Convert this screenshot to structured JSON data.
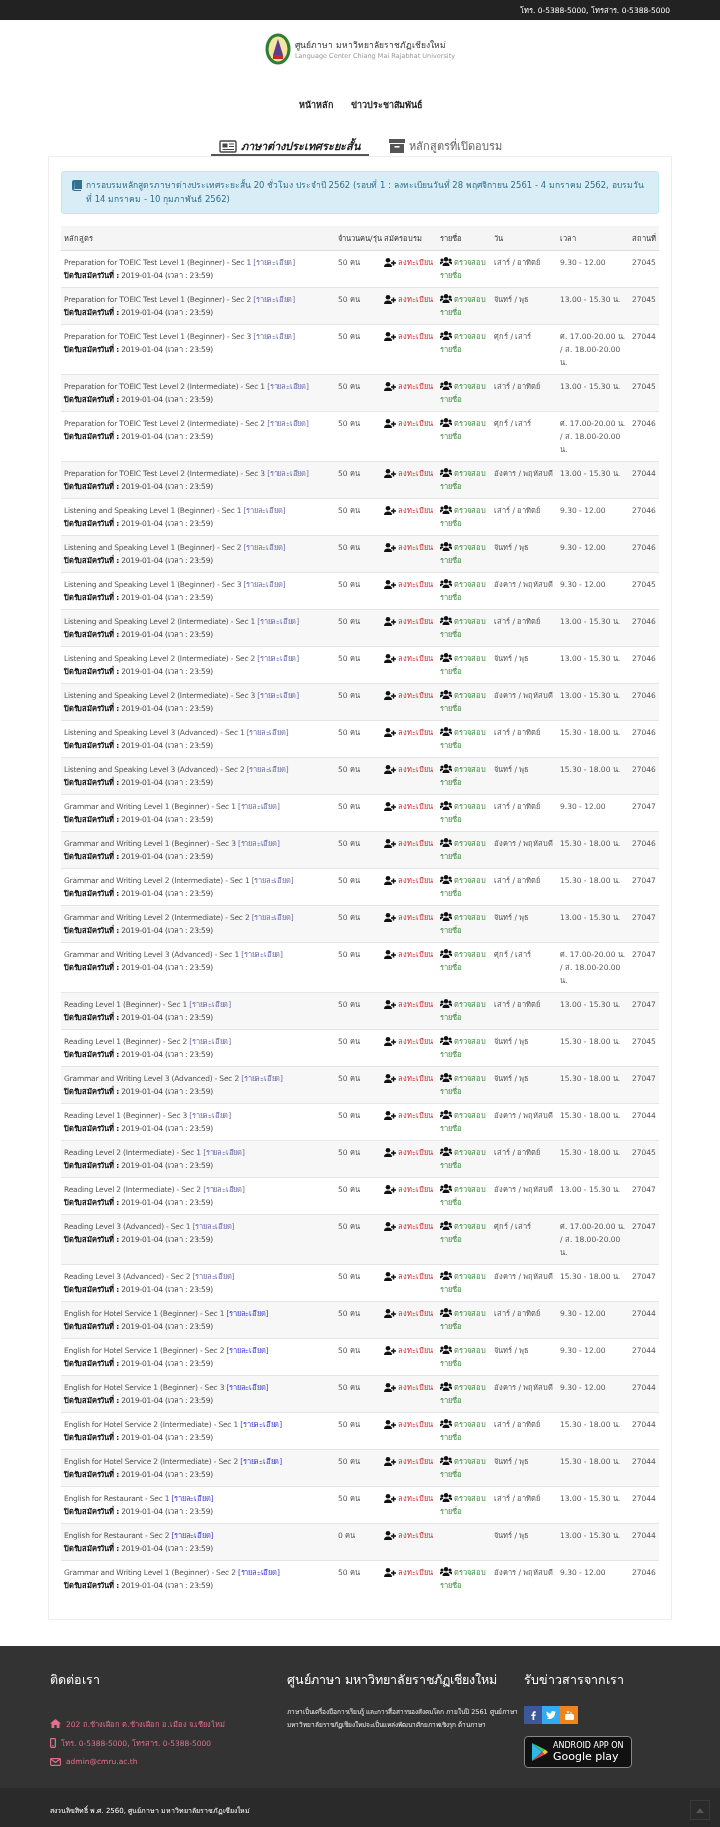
{
  "top_bar": {
    "contact": "โทร. 0-5388-5000, โทรสาร. 0-5388-5000"
  },
  "logo": {
    "title": "ศูนย์ภาษา มหาวิทยาลัยราชภัฏเชียงใหม่",
    "subtitle": "Language Center Chiang Mai Rajabhat University"
  },
  "nav": [
    "หน้าหลัก",
    "ข่าวประชาสัมพันธ์"
  ],
  "tabs": [
    {
      "label": "ภาษาต่างประเทศระยะสั้น",
      "selected": true
    },
    {
      "label": "หลักสูตรที่เปิดอบรม",
      "selected": false
    }
  ],
  "alert": "การอบรมหลักสูตรภาษาต่างประเทศระยะสั้น 20 ชั่วโมง ประจำปี 2562 (รอบที่ 1 : ลงทะเบียนวันที่ 28 พฤศจิกายน 2561 - 4 มกราคม 2562, อบรมวันที่ 14 มกราคม - 10 กุมภาพันธ์ 2562)",
  "table": {
    "columns": [
      "หลักสูตร",
      "จำนวนคน/รุ่น",
      "สมัครอบรม",
      "รายชื่อ",
      "วัน",
      "เวลา",
      "สถานที่"
    ],
    "rows": [
      {
        "course": "Preparation for TOEIC Test Level 1 (Beginner) - Sec 1",
        "detail": "[รายละเอียด]",
        "visited": true,
        "closing": "**ปิดรับสมัครวันที่ :** 2019-01-04 (เวลา : 23:59)",
        "count": "50 คน",
        "register": "ลงทะเบียน",
        "list": "ตรวจสอบรายชื่อ",
        "day": "เสาร์ / อาทิตย์",
        "time": "9.30 - 12.00",
        "place": "27045"
      },
      {
        "course": "Preparation for TOEIC Test Level 1 (Beginner) - Sec 2",
        "detail": "[รายละเอียด]",
        "visited": true,
        "closing": "**ปิดรับสมัครวันที่ :** 2019-01-04 (เวลา : 23:59)",
        "count": "50 คน",
        "register": "ลงทะเบียน",
        "list": "ตรวจสอบรายชื่อ",
        "day": "จันทร์ / พุธ",
        "time": "13.00 - 15.30 น.",
        "place": "27045"
      },
      {
        "course": "Preparation for TOEIC Test Level 1 (Beginner) - Sec 3",
        "detail": "[รายละเอียด]",
        "visited": true,
        "closing": "**ปิดรับสมัครวันที่ :** 2019-01-04 (เวลา : 23:59)",
        "count": "50 คน",
        "register": "ลงทะเบียน",
        "list": "ตรวจสอบรายชื่อ",
        "day": "ศุกร์ / เสาร์",
        "time": "ศ. 17.00-20.00 น. / ส. 18.00-20.00 น.",
        "place": "27044"
      },
      {
        "course": "Preparation for TOEIC Test Level 2 (Intermediate) - Sec 1",
        "detail": "[รายละเอียด]",
        "visited": true,
        "closing": "**ปิดรับสมัครวันที่ :** 2019-01-04 (เวลา : 23:59)",
        "count": "50 คน",
        "register": "ลงทะเบียน",
        "list": "ตรวจสอบรายชื่อ",
        "day": "เสาร์ / อาทิตย์",
        "time": "13.00 - 15.30 น.",
        "place": "27045"
      },
      {
        "course": "Preparation for TOEIC Test Level 2 (Intermediate) - Sec 2",
        "detail": "[รายละเอียด]",
        "visited": true,
        "closing": "**ปิดรับสมัครวันที่ :** 2019-01-04 (เวลา : 23:59)",
        "count": "50 คน",
        "register": "ลงทะเบียน",
        "list": "ตรวจสอบรายชื่อ",
        "day": "ศุกร์ / เสาร์",
        "time": "ศ. 17.00-20.00 น. / ส. 18.00-20.00 น.",
        "place": "27046"
      },
      {
        "course": "Preparation for TOEIC Test Level 2 (Intermediate) - Sec 3",
        "detail": "[รายละเอียด]",
        "visited": true,
        "closing": "**ปิดรับสมัครวันที่ :** 2019-01-04 (เวลา : 23:59)",
        "count": "50 คน",
        "register": "ลงทะเบียน",
        "list": "ตรวจสอบรายชื่อ",
        "day": "อังคาร / พฤหัสบดี",
        "time": "13.00 - 15.30 น.",
        "place": "27044"
      },
      {
        "course": "Listening and Speaking Level 1 (Beginner) - Sec 1",
        "detail": "[รายละเอียด]",
        "visited": true,
        "closing": "**ปิดรับสมัครวันที่ :** 2019-01-04 (เวลา : 23:59)",
        "count": "50 คน",
        "register": "ลงทะเบียน",
        "list": "ตรวจสอบรายชื่อ",
        "day": "เสาร์ / อาทิตย์",
        "time": "9.30 - 12.00",
        "place": "27046"
      },
      {
        "course": "Listening and Speaking Level 1 (Beginner) - Sec 2",
        "detail": "[รายละเอียด]",
        "visited": true,
        "closing": "**ปิดรับสมัครวันที่ :** 2019-01-04 (เวลา : 23:59)",
        "count": "50 คน",
        "register": "ลงทะเบียน",
        "list": "ตรวจสอบรายชื่อ",
        "day": "จันทร์ / พุธ",
        "time": "9.30 - 12.00",
        "place": "27046"
      },
      {
        "course": "Listening and Speaking Level 1 (Beginner) - Sec 3",
        "detail": "[รายละเอียด]",
        "visited": true,
        "closing": "**ปิดรับสมัครวันที่ :** 2019-01-04 (เวลา : 23:59)",
        "count": "50 คน",
        "register": "ลงทะเบียน",
        "list": "ตรวจสอบรายชื่อ",
        "day": "อังคาร / พฤหัสบดี",
        "time": "9.30 - 12.00",
        "place": "27045"
      },
      {
        "course": "Listening and Speaking Level 2 (Intermediate) - Sec 1",
        "detail": "[รายละเอียด]",
        "visited": true,
        "closing": "**ปิดรับสมัครวันที่ :** 2019-01-04 (เวลา : 23:59)",
        "count": "50 คน",
        "register": "ลงทะเบียน",
        "list": "ตรวจสอบรายชื่อ",
        "day": "เสาร์ / อาทิตย์",
        "time": "13.00 - 15.30 น.",
        "place": "27046"
      },
      {
        "course": "Listening and Speaking Level 2 (Intermediate) - Sec 2",
        "detail": "[รายละเอียด]",
        "visited": true,
        "closing": "**ปิดรับสมัครวันที่ :** 2019-01-04 (เวลา : 23:59)",
        "count": "50 คน",
        "register": "ลงทะเบียน",
        "list": "ตรวจสอบรายชื่อ",
        "day": "จันทร์ / พุธ",
        "time": "13.00 - 15.30 น.",
        "place": "27046"
      },
      {
        "course": "Listening and Speaking Level 2 (Intermediate) - Sec 3",
        "detail": "[รายละเอียด]",
        "visited": true,
        "closing": "**ปิดรับสมัครวันที่ :** 2019-01-04 (เวลา : 23:59)",
        "count": "50 คน",
        "register": "ลงทะเบียน",
        "list": "ตรวจสอบรายชื่อ",
        "day": "อังคาร / พฤหัสบดี",
        "time": "13.00 - 15.30 น.",
        "place": "27046"
      },
      {
        "course": "Listening and Speaking Level 3 (Advanced) - Sec 1",
        "detail": "[รายละเอียด]",
        "visited": true,
        "closing": "**ปิดรับสมัครวันที่ :** 2019-01-04 (เวลา : 23:59)",
        "count": "50 คน",
        "register": "ลงทะเบียน",
        "list": "ตรวจสอบรายชื่อ",
        "day": "เสาร์ / อาทิตย์",
        "time": "15.30 - 18.00 น.",
        "place": "27046"
      },
      {
        "course": "Listening and Speaking Level 3 (Advanced) - Sec 2",
        "detail": "[รายละเอียด]",
        "visited": true,
        "closing": "**ปิดรับสมัครวันที่ :** 2019-01-04 (เวลา : 23:59)",
        "count": "50 คน",
        "register": "ลงทะเบียน",
        "list": "ตรวจสอบรายชื่อ",
        "day": "จันทร์ / พุธ",
        "time": "15.30 - 18.00 น.",
        "place": "27046"
      },
      {
        "course": "Grammar and Writing Level 1 (Beginner) - Sec 1",
        "detail": "[รายละเอียด]",
        "visited": true,
        "closing": "**ปิดรับสมัครวันที่ :** 2019-01-04 (เวลา : 23:59)",
        "count": "50 คน",
        "register": "ลงทะเบียน",
        "list": "ตรวจสอบรายชื่อ",
        "day": "เสาร์ / อาทิตย์",
        "time": "9.30 - 12.00",
        "place": "27047"
      },
      {
        "course": "Grammar and Writing Level 1 (Beginner) - Sec 3",
        "detail": "[รายละเอียด]",
        "visited": true,
        "closing": "**ปิดรับสมัครวันที่ :** 2019-01-04 (เวลา : 23:59)",
        "count": "50 คน",
        "register": "ลงทะเบียน",
        "list": "ตรวจสอบรายชื่อ",
        "day": "อังคาร / พฤหัสบดี",
        "time": "15.30 - 18.00 น.",
        "place": "27046"
      },
      {
        "course": "Grammar and Writing Level 2 (Intermediate) - Sec 1",
        "detail": "[รายละเอียด]",
        "visited": true,
        "closing": "**ปิดรับสมัครวันที่ :** 2019-01-04 (เวลา : 23:59)",
        "count": "50 คน",
        "register": "ลงทะเบียน",
        "list": "ตรวจสอบรายชื่อ",
        "day": "เสาร์ / อาทิตย์",
        "time": "15.30 - 18.00 น.",
        "place": "27047"
      },
      {
        "course": "Grammar and Writing Level 2 (Intermediate) - Sec 2",
        "detail": "[รายละเอียด]",
        "visited": true,
        "closing": "**ปิดรับสมัครวันที่ :** 2019-01-04 (เวลา : 23:59)",
        "count": "50 คน",
        "register": "ลงทะเบียน",
        "list": "ตรวจสอบรายชื่อ",
        "day": "จันทร์ / พุธ",
        "time": "13.00 - 15.30 น.",
        "place": "27047"
      },
      {
        "course": "Grammar and Writing Level 3 (Advanced) - Sec 1",
        "detail": "[รายละเอียด]",
        "visited": true,
        "closing": "**ปิดรับสมัครวันที่ :** 2019-01-04 (เวลา : 23:59)",
        "count": "50 คน",
        "register": "ลงทะเบียน",
        "list": "ตรวจสอบรายชื่อ",
        "day": "ศุกร์ / เสาร์",
        "time": "ศ. 17.00-20.00 น. / ส. 18.00-20.00 น.",
        "place": "27047"
      },
      {
        "course": "Reading Level 1 (Beginner) - Sec 1",
        "detail": "[รายละเอียด]",
        "visited": true,
        "closing": "**ปิดรับสมัครวันที่ :** 2019-01-04 (เวลา : 23:59)",
        "count": "50 คน",
        "register": "ลงทะเบียน",
        "list": "ตรวจสอบรายชื่อ",
        "day": "เสาร์ / อาทิตย์",
        "time": "13.00 - 15.30 น.",
        "place": "27047"
      },
      {
        "course": "Reading Level 1 (Beginner) - Sec 2",
        "detail": "[รายละเอียด]",
        "visited": true,
        "closing": "**ปิดรับสมัครวันที่ :** 2019-01-04 (เวลา : 23:59)",
        "count": "50 คน",
        "register": "ลงทะเบียน",
        "list": "ตรวจสอบรายชื่อ",
        "day": "จันทร์ / พุธ",
        "time": "15.30 - 18.00 น.",
        "place": "27045"
      },
      {
        "course": "Grammar and Writing Level 3 (Advanced) - Sec 2",
        "detail": "[รายละเอียด]",
        "visited": true,
        "closing": "**ปิดรับสมัครวันที่ :** 2019-01-04 (เวลา : 23:59)",
        "count": "50 คน",
        "register": "ลงทะเบียน",
        "list": "ตรวจสอบรายชื่อ",
        "day": "จันทร์ / พุธ",
        "time": "15.30 - 18.00 น.",
        "place": "27047"
      },
      {
        "course": "Reading Level 1 (Beginner) - Sec 3",
        "detail": "[รายละเอียด]",
        "visited": true,
        "closing": "**ปิดรับสมัครวันที่ :** 2019-01-04 (เวลา : 23:59)",
        "count": "50 คน",
        "register": "ลงทะเบียน",
        "list": "ตรวจสอบรายชื่อ",
        "day": "อังคาร / พฤหัสบดี",
        "time": "15.30 - 18.00 น.",
        "place": "27044"
      },
      {
        "course": "Reading Level 2 (Intermediate) - Sec 1",
        "detail": "[รายละเอียด]",
        "visited": true,
        "closing": "**ปิดรับสมัครวันที่ :** 2019-01-04 (เวลา : 23:59)",
        "count": "50 คน",
        "register": "ลงทะเบียน",
        "list": "ตรวจสอบรายชื่อ",
        "day": "เสาร์ / อาทิตย์",
        "time": "15.30 - 18.00 น.",
        "place": "27045"
      },
      {
        "course": "Reading Level 2 (Intermediate) - Sec 2",
        "detail": "[รายละเอียด]",
        "visited": true,
        "closing": "**ปิดรับสมัครวันที่ :** 2019-01-04 (เวลา : 23:59)",
        "count": "50 คน",
        "register": "ลงทะเบียน",
        "list": "ตรวจสอบรายชื่อ",
        "day": "อังคาร / พฤหัสบดี",
        "time": "13.00 - 15.30 น.",
        "place": "27047"
      },
      {
        "course": "Reading Level 3 (Advanced) - Sec 1",
        "detail": "[รายละเอียด]",
        "visited": true,
        "closing": "**ปิดรับสมัครวันที่ :** 2019-01-04 (เวลา : 23:59)",
        "count": "50 คน",
        "register": "ลงทะเบียน",
        "list": "ตรวจสอบรายชื่อ",
        "day": "ศุกร์ / เสาร์",
        "time": "ศ. 17.00-20.00 น. / ส. 18.00-20.00 น.",
        "place": "27047"
      },
      {
        "course": "Reading Level 3 (Advanced) - Sec 2",
        "detail": "[รายละเอียด]",
        "visited": true,
        "closing": "**ปิดรับสมัครวันที่ :** 2019-01-04 (เวลา : 23:59)",
        "count": "50 คน",
        "register": "ลงทะเบียน",
        "list": "ตรวจสอบรายชื่อ",
        "day": "อังคาร / พฤหัสบดี",
        "time": "15.30 - 18.00 น.",
        "place": "27047"
      },
      {
        "course": "English for Hotel Service 1 (Beginner) - Sec 1",
        "detail": "[รายละเอียด]",
        "visited": false,
        "closing": "**ปิดรับสมัครวันที่ :** 2019-01-04 (เวลา : 23:59)",
        "count": "50 คน",
        "register": "ลงทะเบียน",
        "list": "ตรวจสอบรายชื่อ",
        "day": "เสาร์ / อาทิตย์",
        "time": "9.30 - 12.00",
        "place": "27044"
      },
      {
        "course": "English for Hotel Service 1 (Beginner) - Sec 2",
        "detail": "[รายละเอียด]",
        "visited": false,
        "closing": "**ปิดรับสมัครวันที่ :** 2019-01-04 (เวลา : 23:59)",
        "count": "50 คน",
        "register": "ลงทะเบียน",
        "list": "ตรวจสอบรายชื่อ",
        "day": "จันทร์ / พุธ",
        "time": "9.30 - 12.00",
        "place": "27044"
      },
      {
        "course": "English for Hotel Service 1 (Beginner) - Sec 3",
        "detail": "[รายละเอียด]",
        "visited": false,
        "closing": "**ปิดรับสมัครวันที่ :** 2019-01-04 (เวลา : 23:59)",
        "count": "50 คน",
        "register": "ลงทะเบียน",
        "list": "ตรวจสอบรายชื่อ",
        "day": "อังคาร / พฤหัสบดี",
        "time": "9.30 - 12.00",
        "place": "27044"
      },
      {
        "course": "English for Hotel Service 2 (Intermediate) - Sec 1",
        "detail": "[รายละเอียด]",
        "visited": false,
        "closing": "**ปิดรับสมัครวันที่ :** 2019-01-04 (เวลา : 23:59)",
        "count": "50 คน",
        "register": "ลงทะเบียน",
        "list": "ตรวจสอบรายชื่อ",
        "day": "เสาร์ / อาทิตย์",
        "time": "15.30 - 18.00 น.",
        "place": "27044"
      },
      {
        "course": "English for Hotel Service 2 (Intermediate) - Sec 2",
        "detail": "[รายละเอียด]",
        "visited": false,
        "closing": "**ปิดรับสมัครวันที่ :** 2019-01-04 (เวลา : 23:59)",
        "count": "50 คน",
        "register": "ลงทะเบียน",
        "list": "ตรวจสอบรายชื่อ",
        "day": "จันทร์ / พุธ",
        "time": "15.30 - 18.00 น.",
        "place": "27044"
      },
      {
        "course": "English for Restaurant - Sec 1",
        "detail": "[รายละเอียด]",
        "visited": false,
        "closing": "**ปิดรับสมัครวันที่ :** 2019-01-04 (เวลา : 23:59)",
        "count": "50 คน",
        "register": "ลงทะเบียน",
        "list": "ตรวจสอบรายชื่อ",
        "day": "เสาร์ / อาทิตย์",
        "time": "13.00 - 15.30 น.",
        "place": "27044"
      },
      {
        "course": "English for Restaurant - Sec 2",
        "detail": "[รายละเอียด]",
        "visited": false,
        "closing": "**ปิดรับสมัครวันที่ :** 2019-01-04 (เวลา : 23:59)",
        "count": "0 คน",
        "register": "ลงทะเบียน",
        "day": "จันทร์ / พุธ",
        "time": "13.00 - 15.30 น.",
        "place": "27044"
      },
      {
        "course": "Grammar and Writing Level 1 (Beginner) - Sec 2",
        "detail": "[รายละเอียด]",
        "visited": false,
        "closing": "**ปิดรับสมัครวันที่ :** 2019-01-04 (เวลา : 23:59)",
        "count": "50 คน",
        "register": "ลงทะเบียน",
        "list": "ตรวจสอบรายชื่อ",
        "day": "อังคาร / พฤหัสบดี",
        "time": "9.30 - 12.00",
        "place": "27046"
      }
    ]
  },
  "footer": {
    "contact_title": "ติดต่อเรา",
    "contact_items": [
      "202 ถ.ช้างเผือก ต.ช้างเผือก อ.เมือง จ.เชียงใหม่",
      "โทร. 0-5388-5000, โทรสาร. 0-5388-5000",
      "admin@cmru.ac.th"
    ],
    "about_title": "ศูนย์ภาษา มหาวิทยาลัยราชภัฏเชียงใหม่",
    "about_text": "ภาษาเป็นเครื่องมือการเรียนรู้ และการสื่อสารของสังคมโลก ภายในปี 2561 ศูนย์ภาษามหาวิทยาลัยราชภัฏเชียงใหม่จะเป็นแหล่งพัฒนาศักยภาพเชิงรุก ด้านภาษา",
    "news_title": "รับข่าวสารจากเรา",
    "badge_small": "ANDROID APP ON",
    "badge_large": "Google play",
    "copyright": "สงวนลิขสิทธิ์ พ.ศ. 2560, ศูนย์ภาษา มหาวิทยาลัยราชภัฏเชียงใหม่"
  }
}
